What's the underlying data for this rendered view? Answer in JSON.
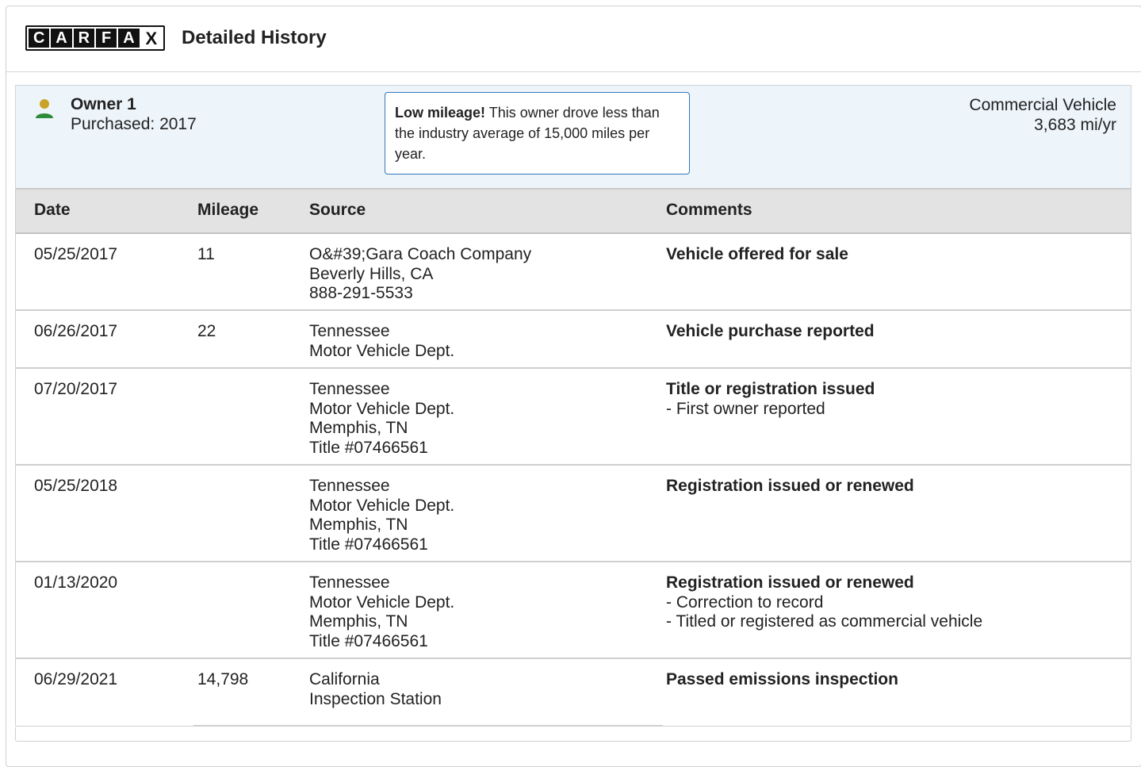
{
  "header": {
    "logo_letters": [
      "C",
      "A",
      "R",
      "F",
      "A",
      "X"
    ],
    "title": "Detailed History"
  },
  "owner": {
    "name": "Owner 1",
    "purchased": "Purchased: 2017",
    "notice_bold": "Low mileage!",
    "notice_text": " This owner drove less than the industry average of 15,000 miles per year.",
    "type": "Commercial Vehicle",
    "rate": "3,683 mi/yr",
    "icon": "person-icon",
    "icon_colors": {
      "head": "#c9a227",
      "body": "#2e8b3a"
    }
  },
  "table": {
    "headers": {
      "date": "Date",
      "mileage": "Mileage",
      "source": "Source",
      "comments": "Comments"
    },
    "rows": [
      {
        "date": "05/25/2017",
        "mileage": "11",
        "source": [
          "O&#39;Gara Coach Company",
          "Beverly Hills, CA",
          "888-291-5533"
        ],
        "comment_title": "Vehicle offered for sale",
        "comment_items": []
      },
      {
        "date": "06/26/2017",
        "mileage": "22",
        "source": [
          "Tennessee",
          "Motor Vehicle Dept."
        ],
        "comment_title": "Vehicle purchase reported",
        "comment_items": []
      },
      {
        "date": "07/20/2017",
        "mileage": "",
        "source": [
          "Tennessee",
          "Motor Vehicle Dept.",
          "Memphis, TN",
          "Title #07466561"
        ],
        "comment_title": "Title or registration issued",
        "comment_items": [
          "First owner reported"
        ]
      },
      {
        "date": "05/25/2018",
        "mileage": "",
        "source": [
          "Tennessee",
          "Motor Vehicle Dept.",
          "Memphis, TN",
          "Title #07466561"
        ],
        "comment_title": "Registration issued or renewed",
        "comment_items": []
      },
      {
        "date": "01/13/2020",
        "mileage": "",
        "source": [
          "Tennessee",
          "Motor Vehicle Dept.",
          "Memphis, TN",
          "Title #07466561"
        ],
        "comment_title": "Registration issued or renewed",
        "comment_items": [
          "Correction to record",
          "Titled or registered as commercial vehicle"
        ]
      },
      {
        "date": "06/29/2021",
        "mileage": "14,798",
        "source": [
          "California",
          "Inspection Station"
        ],
        "comment_title": "Passed emissions inspection",
        "comment_items": []
      }
    ]
  }
}
